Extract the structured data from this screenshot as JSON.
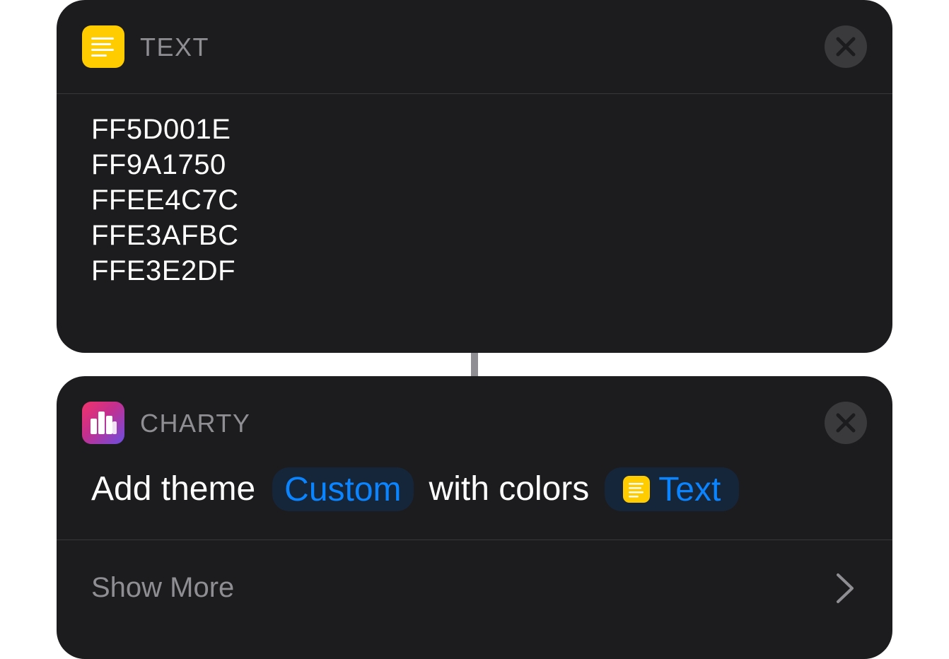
{
  "connector": {
    "color": "#8e8e93"
  },
  "text_action": {
    "app_name": "TEXT",
    "icon": "text-align-left-icon",
    "icon_color": "#ffcc00",
    "close_icon": "close-icon",
    "lines": [
      "FF5D001E",
      "FF9A1750",
      "FFEE4C7C",
      "FFE3AFBC",
      "FFE3E2DF"
    ]
  },
  "charty_action": {
    "app_name": "CHARTY",
    "icon": "bar-chart-icon",
    "close_icon": "close-icon",
    "phrase_1": "Add theme",
    "theme_token": "Custom",
    "phrase_2": "with colors",
    "colors_token": "Text",
    "colors_token_icon": "text-align-left-icon",
    "show_more": "Show More",
    "show_more_icon": "chevron-right-icon",
    "accent_color": "#0a84ff"
  }
}
